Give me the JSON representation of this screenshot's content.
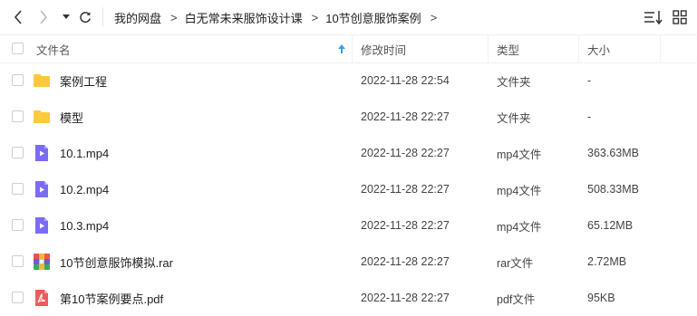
{
  "toolbar": {
    "breadcrumb": [
      "我的网盘",
      "白无常未来服饰设计课",
      "10节创意服饰案例"
    ],
    "separator": ">"
  },
  "columns": {
    "name": "文件名",
    "modified": "修改时间",
    "type": "类型",
    "size": "大小"
  },
  "colors": {
    "folder": "#ffc93c",
    "video": "#7b6cf6",
    "pdf": "#f05a5a",
    "sort_arrow": "#3aa0e6"
  },
  "files": [
    {
      "name": "案例工程",
      "modified": "2022-11-28 22:54",
      "type": "文件夹",
      "size": "-",
      "icon": "folder-icon"
    },
    {
      "name": "模型",
      "modified": "2022-11-28 22:27",
      "type": "文件夹",
      "size": "-",
      "icon": "folder-icon"
    },
    {
      "name": "10.1.mp4",
      "modified": "2022-11-28 22:27",
      "type": "mp4文件",
      "size": "363.63MB",
      "icon": "video-file-icon"
    },
    {
      "name": "10.2.mp4",
      "modified": "2022-11-28 22:27",
      "type": "mp4文件",
      "size": "508.33MB",
      "icon": "video-file-icon"
    },
    {
      "name": "10.3.mp4",
      "modified": "2022-11-28 22:27",
      "type": "mp4文件",
      "size": "65.12MB",
      "icon": "video-file-icon"
    },
    {
      "name": "10节创意服饰模拟.rar",
      "modified": "2022-11-28 22:27",
      "type": "rar文件",
      "size": "2.72MB",
      "icon": "archive-file-icon"
    },
    {
      "name": "第10节案例要点.pdf",
      "modified": "2022-11-28 22:27",
      "type": "pdf文件",
      "size": "95KB",
      "icon": "pdf-file-icon"
    }
  ]
}
